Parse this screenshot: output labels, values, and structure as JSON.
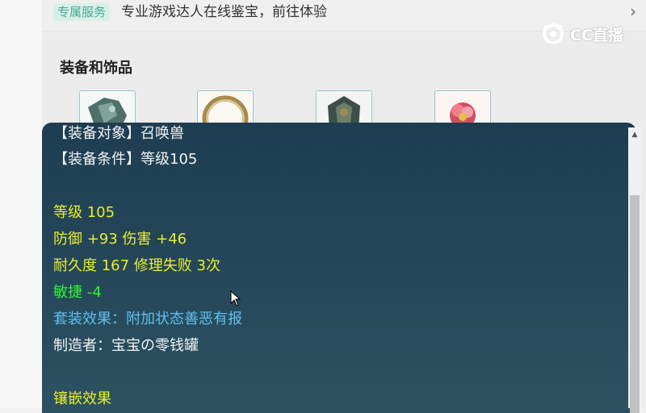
{
  "banner": {
    "badge": "专属服务",
    "text": "专业游戏达人在线鉴宝，前往体验",
    "chevron_icon": "chevron-right-icon"
  },
  "logo": {
    "text": "CC直播",
    "icon": "cc-logo-icon"
  },
  "section": {
    "title": "装备和饰品"
  },
  "equipment": [
    {
      "name": "armor-item",
      "icon": "armor-icon"
    },
    {
      "name": "ring-item",
      "icon": "ring-icon"
    },
    {
      "name": "shield-item",
      "icon": "shield-icon"
    },
    {
      "name": "flower-item",
      "icon": "flower-icon"
    }
  ],
  "tooltip": {
    "lines": [
      {
        "text": "【装备对象】召唤兽",
        "color": "#f2f2f2"
      },
      {
        "text": "【装备条件】等级105",
        "color": "#f2f2f2"
      },
      {
        "text": "等级 105",
        "color": "#e9ee2a"
      },
      {
        "text": "防御 +93 伤害 +46",
        "color": "#e9ee2a"
      },
      {
        "text": "耐久度 167 修理失败 3次",
        "color": "#e9ee2a"
      },
      {
        "text": "敏捷 -4",
        "color": "#2ff42f"
      },
      {
        "text": "套装效果：附加状态善恶有报",
        "color": "#5ec1ee"
      },
      {
        "text": "制造者：宝宝の零钱罐",
        "color": "#f2f2f2"
      },
      {
        "text": "镶嵌效果",
        "color": "#e9ee2a"
      }
    ]
  },
  "scrollbar": {
    "up_icon": "scroll-up-arrow-icon"
  },
  "cursor": {
    "icon": "mouse-pointer-icon"
  }
}
